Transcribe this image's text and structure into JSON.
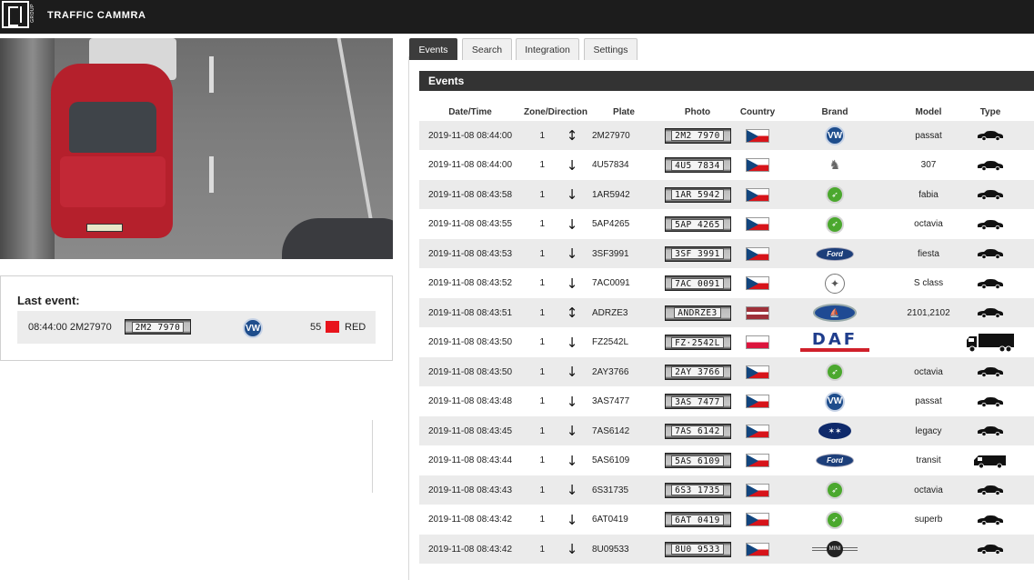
{
  "app": {
    "title": "TRAFFIC CAMMRA",
    "logo_sub": "GROUP"
  },
  "tabs": [
    {
      "label": "Events",
      "active": true
    },
    {
      "label": "Search",
      "active": false
    },
    {
      "label": "Integration",
      "active": false
    },
    {
      "label": "Settings",
      "active": false
    }
  ],
  "camera": {
    "plate_text": "8Z2 7970"
  },
  "last_event": {
    "title": "Last event:",
    "time_plate": "08:44:00 2M27970",
    "plate_image_text": "2M2 7970",
    "brand": "volkswagen",
    "speed": "55",
    "light": "RED",
    "light_color": "#e8141c"
  },
  "events": {
    "title": "Events",
    "columns": [
      "Date/Time",
      "Zone/Direction",
      "Plate",
      "Photo",
      "Country",
      "Brand",
      "Model",
      "Type"
    ],
    "rows": [
      {
        "datetime": "2019-11-08 08:44:00",
        "zone": "1",
        "direction": "both",
        "plate": "2M27970",
        "photo": "2M2 7970",
        "country": "cz",
        "brand": "volkswagen",
        "model": "passat",
        "type": "car"
      },
      {
        "datetime": "2019-11-08 08:44:00",
        "zone": "1",
        "direction": "down",
        "plate": "4U57834",
        "photo": "4U5 7834",
        "country": "cz",
        "brand": "peugeot",
        "model": "307",
        "type": "car"
      },
      {
        "datetime": "2019-11-08 08:43:58",
        "zone": "1",
        "direction": "down",
        "plate": "1AR5942",
        "photo": "1AR 5942",
        "country": "cz",
        "brand": "skoda",
        "model": "fabia",
        "type": "car"
      },
      {
        "datetime": "2019-11-08 08:43:55",
        "zone": "1",
        "direction": "down",
        "plate": "5AP4265",
        "photo": "5AP 4265",
        "country": "cz",
        "brand": "skoda",
        "model": "octavia",
        "type": "car"
      },
      {
        "datetime": "2019-11-08 08:43:53",
        "zone": "1",
        "direction": "down",
        "plate": "3SF3991",
        "photo": "3SF 3991",
        "country": "cz",
        "brand": "ford",
        "model": "fiesta",
        "type": "car"
      },
      {
        "datetime": "2019-11-08 08:43:52",
        "zone": "1",
        "direction": "down",
        "plate": "7AC0091",
        "photo": "7AC 0091",
        "country": "cz",
        "brand": "mercedes",
        "model": "S class",
        "type": "car"
      },
      {
        "datetime": "2019-11-08 08:43:51",
        "zone": "1",
        "direction": "both",
        "plate": "ADRZE3",
        "photo": "ANDRZE3",
        "country": "lv",
        "brand": "lada",
        "model": "2101,2102",
        "type": "car"
      },
      {
        "datetime": "2019-11-08 08:43:50",
        "zone": "1",
        "direction": "down",
        "plate": "FZ2542L",
        "photo": "FZ·2542L",
        "country": "pl",
        "brand": "daf",
        "model": "",
        "type": "truck"
      },
      {
        "datetime": "2019-11-08 08:43:50",
        "zone": "1",
        "direction": "down",
        "plate": "2AY3766",
        "photo": "2AY 3766",
        "country": "cz",
        "brand": "skoda",
        "model": "octavia",
        "type": "car"
      },
      {
        "datetime": "2019-11-08 08:43:48",
        "zone": "1",
        "direction": "down",
        "plate": "3AS7477",
        "photo": "3AS 7477",
        "country": "cz",
        "brand": "volkswagen",
        "model": "passat",
        "type": "car"
      },
      {
        "datetime": "2019-11-08 08:43:45",
        "zone": "1",
        "direction": "down",
        "plate": "7AS6142",
        "photo": "7AS 6142",
        "country": "cz",
        "brand": "subaru",
        "model": "legacy",
        "type": "car"
      },
      {
        "datetime": "2019-11-08 08:43:44",
        "zone": "1",
        "direction": "down",
        "plate": "5AS6109",
        "photo": "5AS 6109",
        "country": "cz",
        "brand": "ford",
        "model": "transit",
        "type": "van"
      },
      {
        "datetime": "2019-11-08 08:43:43",
        "zone": "1",
        "direction": "down",
        "plate": "6S31735",
        "photo": "6S3 1735",
        "country": "cz",
        "brand": "skoda",
        "model": "octavia",
        "type": "car"
      },
      {
        "datetime": "2019-11-08 08:43:42",
        "zone": "1",
        "direction": "down",
        "plate": "6AT0419",
        "photo": "6AT 0419",
        "country": "cz",
        "brand": "skoda",
        "model": "superb",
        "type": "car"
      },
      {
        "datetime": "2019-11-08 08:43:42",
        "zone": "1",
        "direction": "down",
        "plate": "8U09533",
        "photo": "8U0 9533",
        "country": "cz",
        "brand": "mini",
        "model": "",
        "type": "car"
      }
    ]
  }
}
